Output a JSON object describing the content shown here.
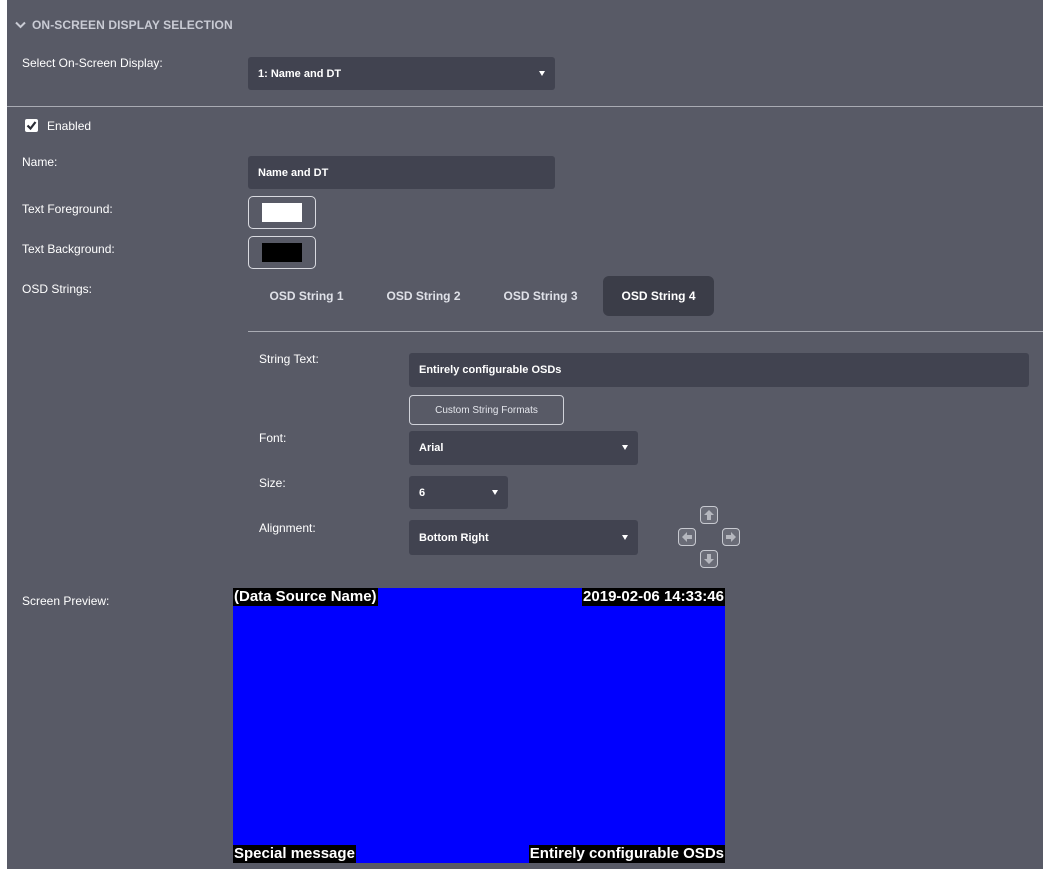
{
  "section": {
    "title": "ON-SCREEN DISPLAY SELECTION",
    "icon": "chevron-down-icon"
  },
  "osd_select": {
    "label": "Select On-Screen Display:",
    "value": "1: Name and DT"
  },
  "enabled": {
    "label": "Enabled",
    "checked": true
  },
  "name": {
    "label": "Name:",
    "value": "Name and DT"
  },
  "text_foreground": {
    "label": "Text Foreground:",
    "color": "#ffffff"
  },
  "text_background": {
    "label": "Text Background:",
    "color": "#000000"
  },
  "osd_strings": {
    "label": "OSD Strings:",
    "tabs": [
      {
        "label": "OSD String 1",
        "active": false
      },
      {
        "label": "OSD String 2",
        "active": false
      },
      {
        "label": "OSD String 3",
        "active": false
      },
      {
        "label": "OSD String 4",
        "active": true
      }
    ]
  },
  "string_editor": {
    "string_text_label": "String Text:",
    "string_text_value": "Entirely configurable OSDs",
    "custom_formats_button": "Custom String Formats",
    "font_label": "Font:",
    "font_value": "Arial",
    "size_label": "Size:",
    "size_value": "6",
    "alignment_label": "Alignment:",
    "alignment_value": "Bottom Right",
    "alignment_arrows": [
      "arrow-up-icon",
      "arrow-left-icon",
      "arrow-right-icon",
      "arrow-down-icon"
    ]
  },
  "preview": {
    "label": "Screen Preview:",
    "background_color": "#0000ff",
    "top_left": "(Data Source Name)",
    "top_right": "2019-02-06 14:33:46",
    "bottom_left": "Special message",
    "bottom_right": "Entirely configurable OSDs"
  },
  "colors": {
    "panel_bg": "#585a66",
    "field_bg": "#414350",
    "active_tab_bg": "#3b3d48"
  }
}
